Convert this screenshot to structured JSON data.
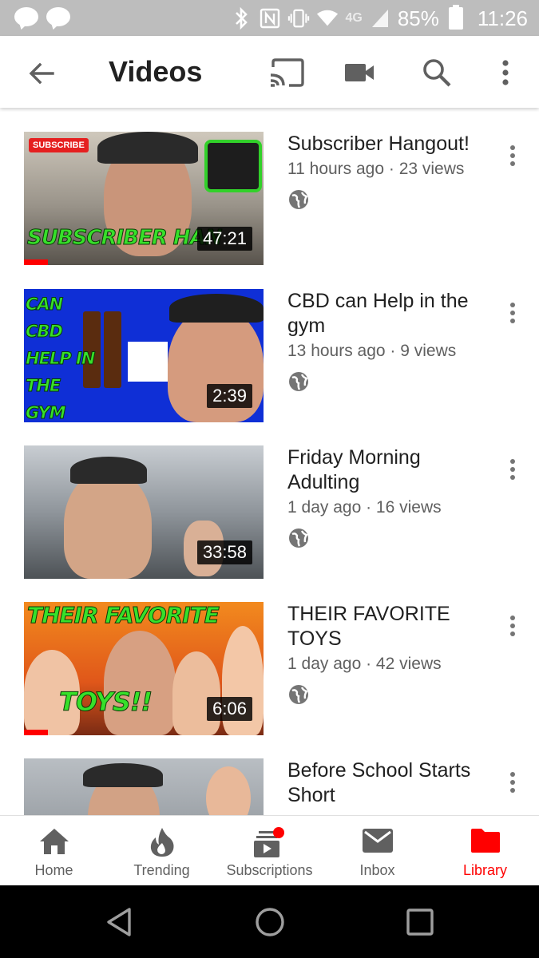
{
  "status_bar": {
    "network": "4G",
    "battery": "85%",
    "time": "11:26"
  },
  "app_bar": {
    "title": "Videos",
    "actions": [
      "cast-icon",
      "video-camera-icon",
      "search-icon",
      "more-vert-icon"
    ]
  },
  "videos": [
    {
      "title": "Subscriber Hangout!",
      "age": "11 hours ago",
      "views": "23 views",
      "subtitle": "11 hours ago · 23 views",
      "duration": "47:21",
      "visibility": "public",
      "watched_fraction": 0.1,
      "thumb_text": "SUBSCRIBER HAN",
      "badge": "SUBSCRIBE"
    },
    {
      "title": "CBD can Help in the gym",
      "age": "13 hours ago",
      "views": "9 views",
      "subtitle": "13 hours ago · 9 views",
      "duration": "2:39",
      "visibility": "public",
      "watched_fraction": 0,
      "thumb_text": "CAN CBD HELP IN THE GYM"
    },
    {
      "title": "Friday Morning Adulting",
      "age": "1 day ago",
      "views": "16 views",
      "subtitle": "1 day ago · 16 views",
      "duration": "33:58",
      "visibility": "public",
      "watched_fraction": 0
    },
    {
      "title": "THEIR FAVORITE TOYS",
      "age": "1 day ago",
      "views": "42 views",
      "subtitle": "1 day ago · 42 views",
      "duration": "6:06",
      "visibility": "public",
      "watched_fraction": 0.1,
      "thumb_text": "THEIR FAVORITE",
      "thumb_text_2": "TOYS!!"
    },
    {
      "title": "Before School Starts Short",
      "age": "",
      "views": "",
      "subtitle": "",
      "duration": "",
      "visibility": "public",
      "watched_fraction": 0
    }
  ],
  "bottom_nav": [
    {
      "label": "Home",
      "icon": "home-icon",
      "active": false
    },
    {
      "label": "Trending",
      "icon": "flame-icon",
      "active": false
    },
    {
      "label": "Subscriptions",
      "icon": "subscriptions-icon",
      "active": false,
      "badge": true
    },
    {
      "label": "Inbox",
      "icon": "mail-icon",
      "active": false
    },
    {
      "label": "Library",
      "icon": "folder-icon",
      "active": true
    }
  ],
  "colors": {
    "accent": "#ff0000",
    "status_bar": "#bdbdbd",
    "icon": "#606060",
    "text": "#212121"
  }
}
